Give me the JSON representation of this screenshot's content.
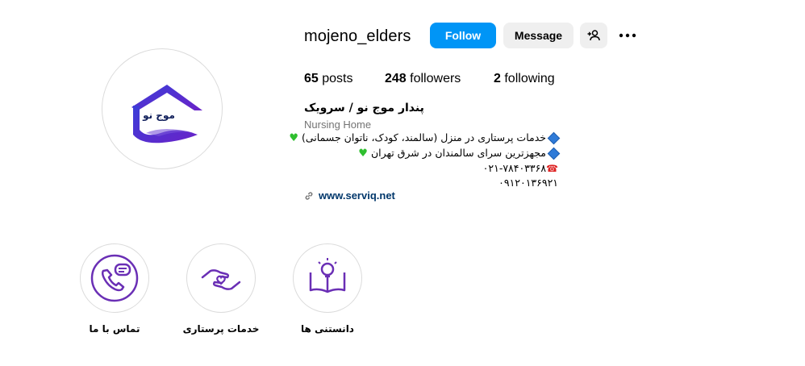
{
  "profile": {
    "username": "mojeno_elders",
    "avatar_text": "موج نو"
  },
  "actions": {
    "follow_label": "Follow",
    "message_label": "Message",
    "add_user_icon": "person-add-icon",
    "more_icon": "more-dots-icon"
  },
  "stats": {
    "posts_count": "65",
    "posts_label": "posts",
    "followers_count": "248",
    "followers_label": "followers",
    "following_count": "2",
    "following_label": "following"
  },
  "bio": {
    "name": "پندار موج نو / سرویک",
    "category": "Nursing Home",
    "line1": "خدمات پرستاری در منزل (سالمند، کودک، ناتوان جسمانی)",
    "line2": "مجهزترین سرای سالمندان در شرق تهران",
    "line3": "۰۲۱-۷۸۴۰۳۳۶۸",
    "line4": "۰۹۱۲۰۱۳۶۹۲۱",
    "link": "www.serviq.net"
  },
  "highlights": [
    {
      "label": "تماس با ما",
      "icon": "phone-chat-icon"
    },
    {
      "label": "خدمات پرستاری",
      "icon": "care-hands-icon"
    },
    {
      "label": "دانستنی ها",
      "icon": "book-lightbulb-icon"
    }
  ],
  "colors": {
    "follow_blue": "#0095f6",
    "button_gray": "#efefef",
    "highlight_purple": "#6a2fb5",
    "link_blue": "#00376b",
    "logo_blue": "#2a2fc9"
  }
}
